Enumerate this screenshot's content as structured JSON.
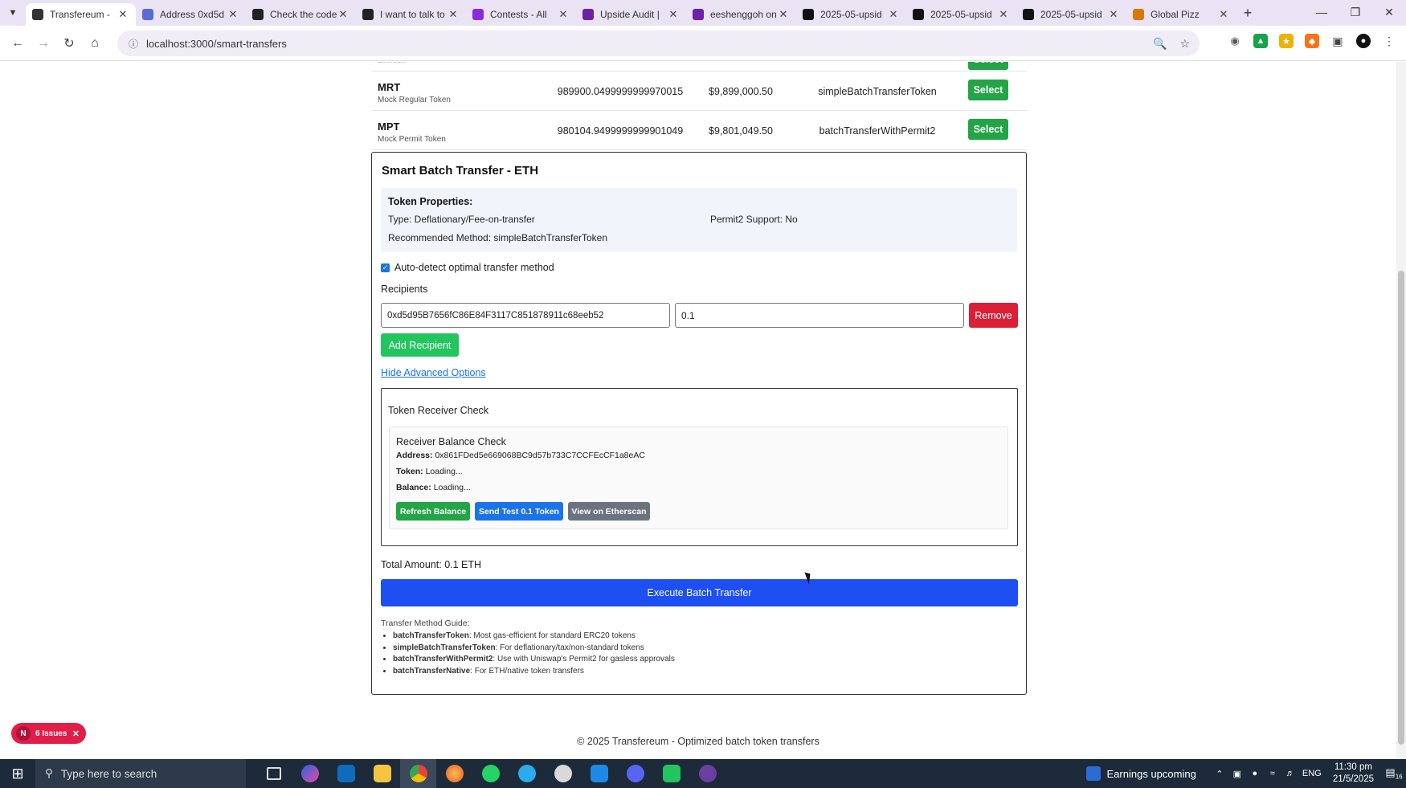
{
  "browser": {
    "tabs": [
      {
        "title": "Transfereum - ",
        "color": "#333333",
        "active": true
      },
      {
        "title": "Address 0xd5d",
        "color": "#5a6bd6",
        "active": false
      },
      {
        "title": "Check the code",
        "color": "#222222",
        "active": false
      },
      {
        "title": "I want to talk to",
        "color": "#222222",
        "active": false
      },
      {
        "title": "Contests - All",
        "color": "#8a2be2",
        "active": false
      },
      {
        "title": "Upside Audit |",
        "color": "#6b21a8",
        "active": false
      },
      {
        "title": "eeshenggoh on",
        "color": "#6b21a8",
        "active": false
      },
      {
        "title": "2025-05-upsid",
        "color": "#111111",
        "active": false
      },
      {
        "title": "2025-05-upsid",
        "color": "#111111",
        "active": false
      },
      {
        "title": "2025-05-upsid",
        "color": "#111111",
        "active": false
      },
      {
        "title": "Global Pizz",
        "color": "#d97706",
        "active": false
      }
    ],
    "url": "localhost:3000/smart-transfers"
  },
  "tokens": [
    {
      "symbol": "",
      "name": "Ethereum",
      "balance": "",
      "value": "",
      "method": "",
      "select_label": "Select",
      "partial": true
    },
    {
      "symbol": "MRT",
      "name": "Mock Regular Token",
      "balance": "989900.0499999999970015",
      "value": "$9,899,000.50",
      "method": "simpleBatchTransferToken",
      "select_label": "Select",
      "partial": false
    },
    {
      "symbol": "MPT",
      "name": "Mock Permit Token",
      "balance": "980104.9499999999901049",
      "value": "$9,801,049.50",
      "method": "batchTransferWithPermit2",
      "select_label": "Select",
      "partial": false
    }
  ],
  "transfer": {
    "title": "Smart Batch Transfer - ETH",
    "props_heading": "Token Properties:",
    "type": "Type: Deflationary/Fee-on-transfer",
    "permit2": "Permit2 Support: No",
    "recommended": "Recommended Method: simpleBatchTransferToken",
    "auto_detect": "Auto-detect optimal transfer method",
    "recipients_label": "Recipients",
    "recipient_address": "0xd5d95B7656fC86E84F3117C851878911c68eeb52",
    "recipient_amount": "0.1",
    "remove_label": "Remove",
    "add_label": "Add Recipient",
    "advanced_link": "Hide Advanced Options",
    "receiver_check_title": "Token Receiver Check",
    "balance_check_title": "Receiver Balance Check",
    "address_label": "Address:",
    "address_value": "0x861FDed5e669068BC9d57b733C7CCFEcCF1a8eAC",
    "token_label": "Token:",
    "token_value": "Loading...",
    "balance_label": "Balance:",
    "balance_value": "Loading...",
    "refresh_label": "Refresh Balance",
    "send_test_label": "Send Test 0.1 Token",
    "etherscan_label": "View on Etherscan",
    "total": "Total Amount: 0.1 ETH",
    "execute_label": "Execute Batch Transfer",
    "guide_heading": "Transfer Method Guide:",
    "guide": [
      {
        "method": "batchTransferToken",
        "desc": ": Most gas-efficient for standard ERC20 tokens"
      },
      {
        "method": "simpleBatchTransferToken",
        "desc": ": For deflationary/tax/non-standard tokens"
      },
      {
        "method": "batchTransferWithPermit2",
        "desc": ": Use with Uniswap's Permit2 for gasless approvals"
      },
      {
        "method": "batchTransferNative",
        "desc": ": For ETH/native token transfers"
      }
    ]
  },
  "footer": "© 2025 Transfereum - Optimized batch token transfers",
  "issues_badge": {
    "letter": "N",
    "text": "6 Issues"
  },
  "taskbar": {
    "search_placeholder": "Type here to search",
    "news": "Earnings upcoming",
    "lang": "ENG",
    "time": "11:30 pm",
    "date": "21/5/2025",
    "notif_count": "16"
  }
}
